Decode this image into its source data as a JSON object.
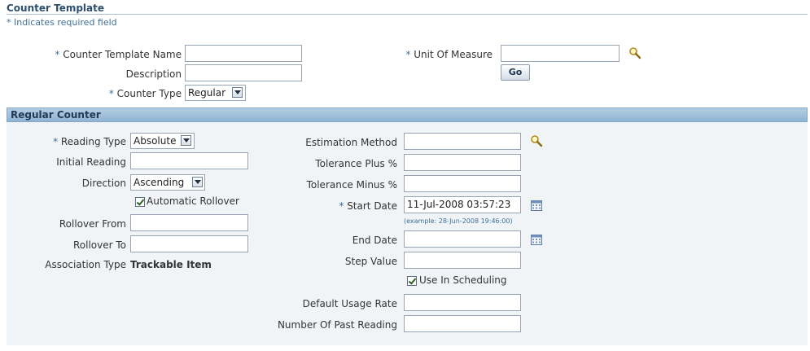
{
  "header": {
    "title": "Counter Template",
    "required_note": "* Indicates required field"
  },
  "template_form": {
    "counter_template_name": {
      "label": "Counter Template Name",
      "required": "*",
      "value": ""
    },
    "description": {
      "label": "Description",
      "value": ""
    },
    "counter_type": {
      "label": "Counter Type",
      "required": "*",
      "value": "Regular"
    },
    "unit_of_measure": {
      "label": "Unit Of Measure",
      "required": "*",
      "value": ""
    },
    "go_label": "Go"
  },
  "regular_counter": {
    "section_title": "Regular Counter",
    "reading_type": {
      "label": "Reading Type",
      "required": "*",
      "value": "Absolute"
    },
    "initial_reading": {
      "label": "Initial Reading",
      "value": ""
    },
    "direction": {
      "label": "Direction",
      "value": "Ascending"
    },
    "automatic_rollover": {
      "label": "Automatic Rollover",
      "checked": true
    },
    "rollover_from": {
      "label": "Rollover From",
      "value": ""
    },
    "rollover_to": {
      "label": "Rollover To",
      "value": ""
    },
    "association_type": {
      "label": "Association Type",
      "value": "Trackable Item"
    },
    "estimation_method": {
      "label": "Estimation Method",
      "value": ""
    },
    "tolerance_plus": {
      "label": "Tolerance Plus %",
      "value": ""
    },
    "tolerance_minus": {
      "label": "Tolerance Minus %",
      "value": ""
    },
    "start_date": {
      "label": "Start Date",
      "required": "*",
      "value": "11-Jul-2008 03:57:23",
      "hint": "(example: 28-Jun-2008 19:46:00)"
    },
    "end_date": {
      "label": "End Date",
      "value": ""
    },
    "step_value": {
      "label": "Step Value",
      "value": ""
    },
    "use_in_scheduling": {
      "label": "Use In Scheduling",
      "checked": true
    },
    "default_usage_rate": {
      "label": "Default Usage Rate",
      "value": ""
    },
    "number_of_past_reading": {
      "label": "Number Of Past Reading",
      "value": ""
    }
  },
  "colors": {
    "accent": "#3d6f99",
    "section_band": "#9fc0dc",
    "section_body": "#f1f4f7"
  },
  "icons": [
    "search-icon",
    "calendar-icon",
    "chevron-down-icon",
    "checkmark-icon"
  ]
}
